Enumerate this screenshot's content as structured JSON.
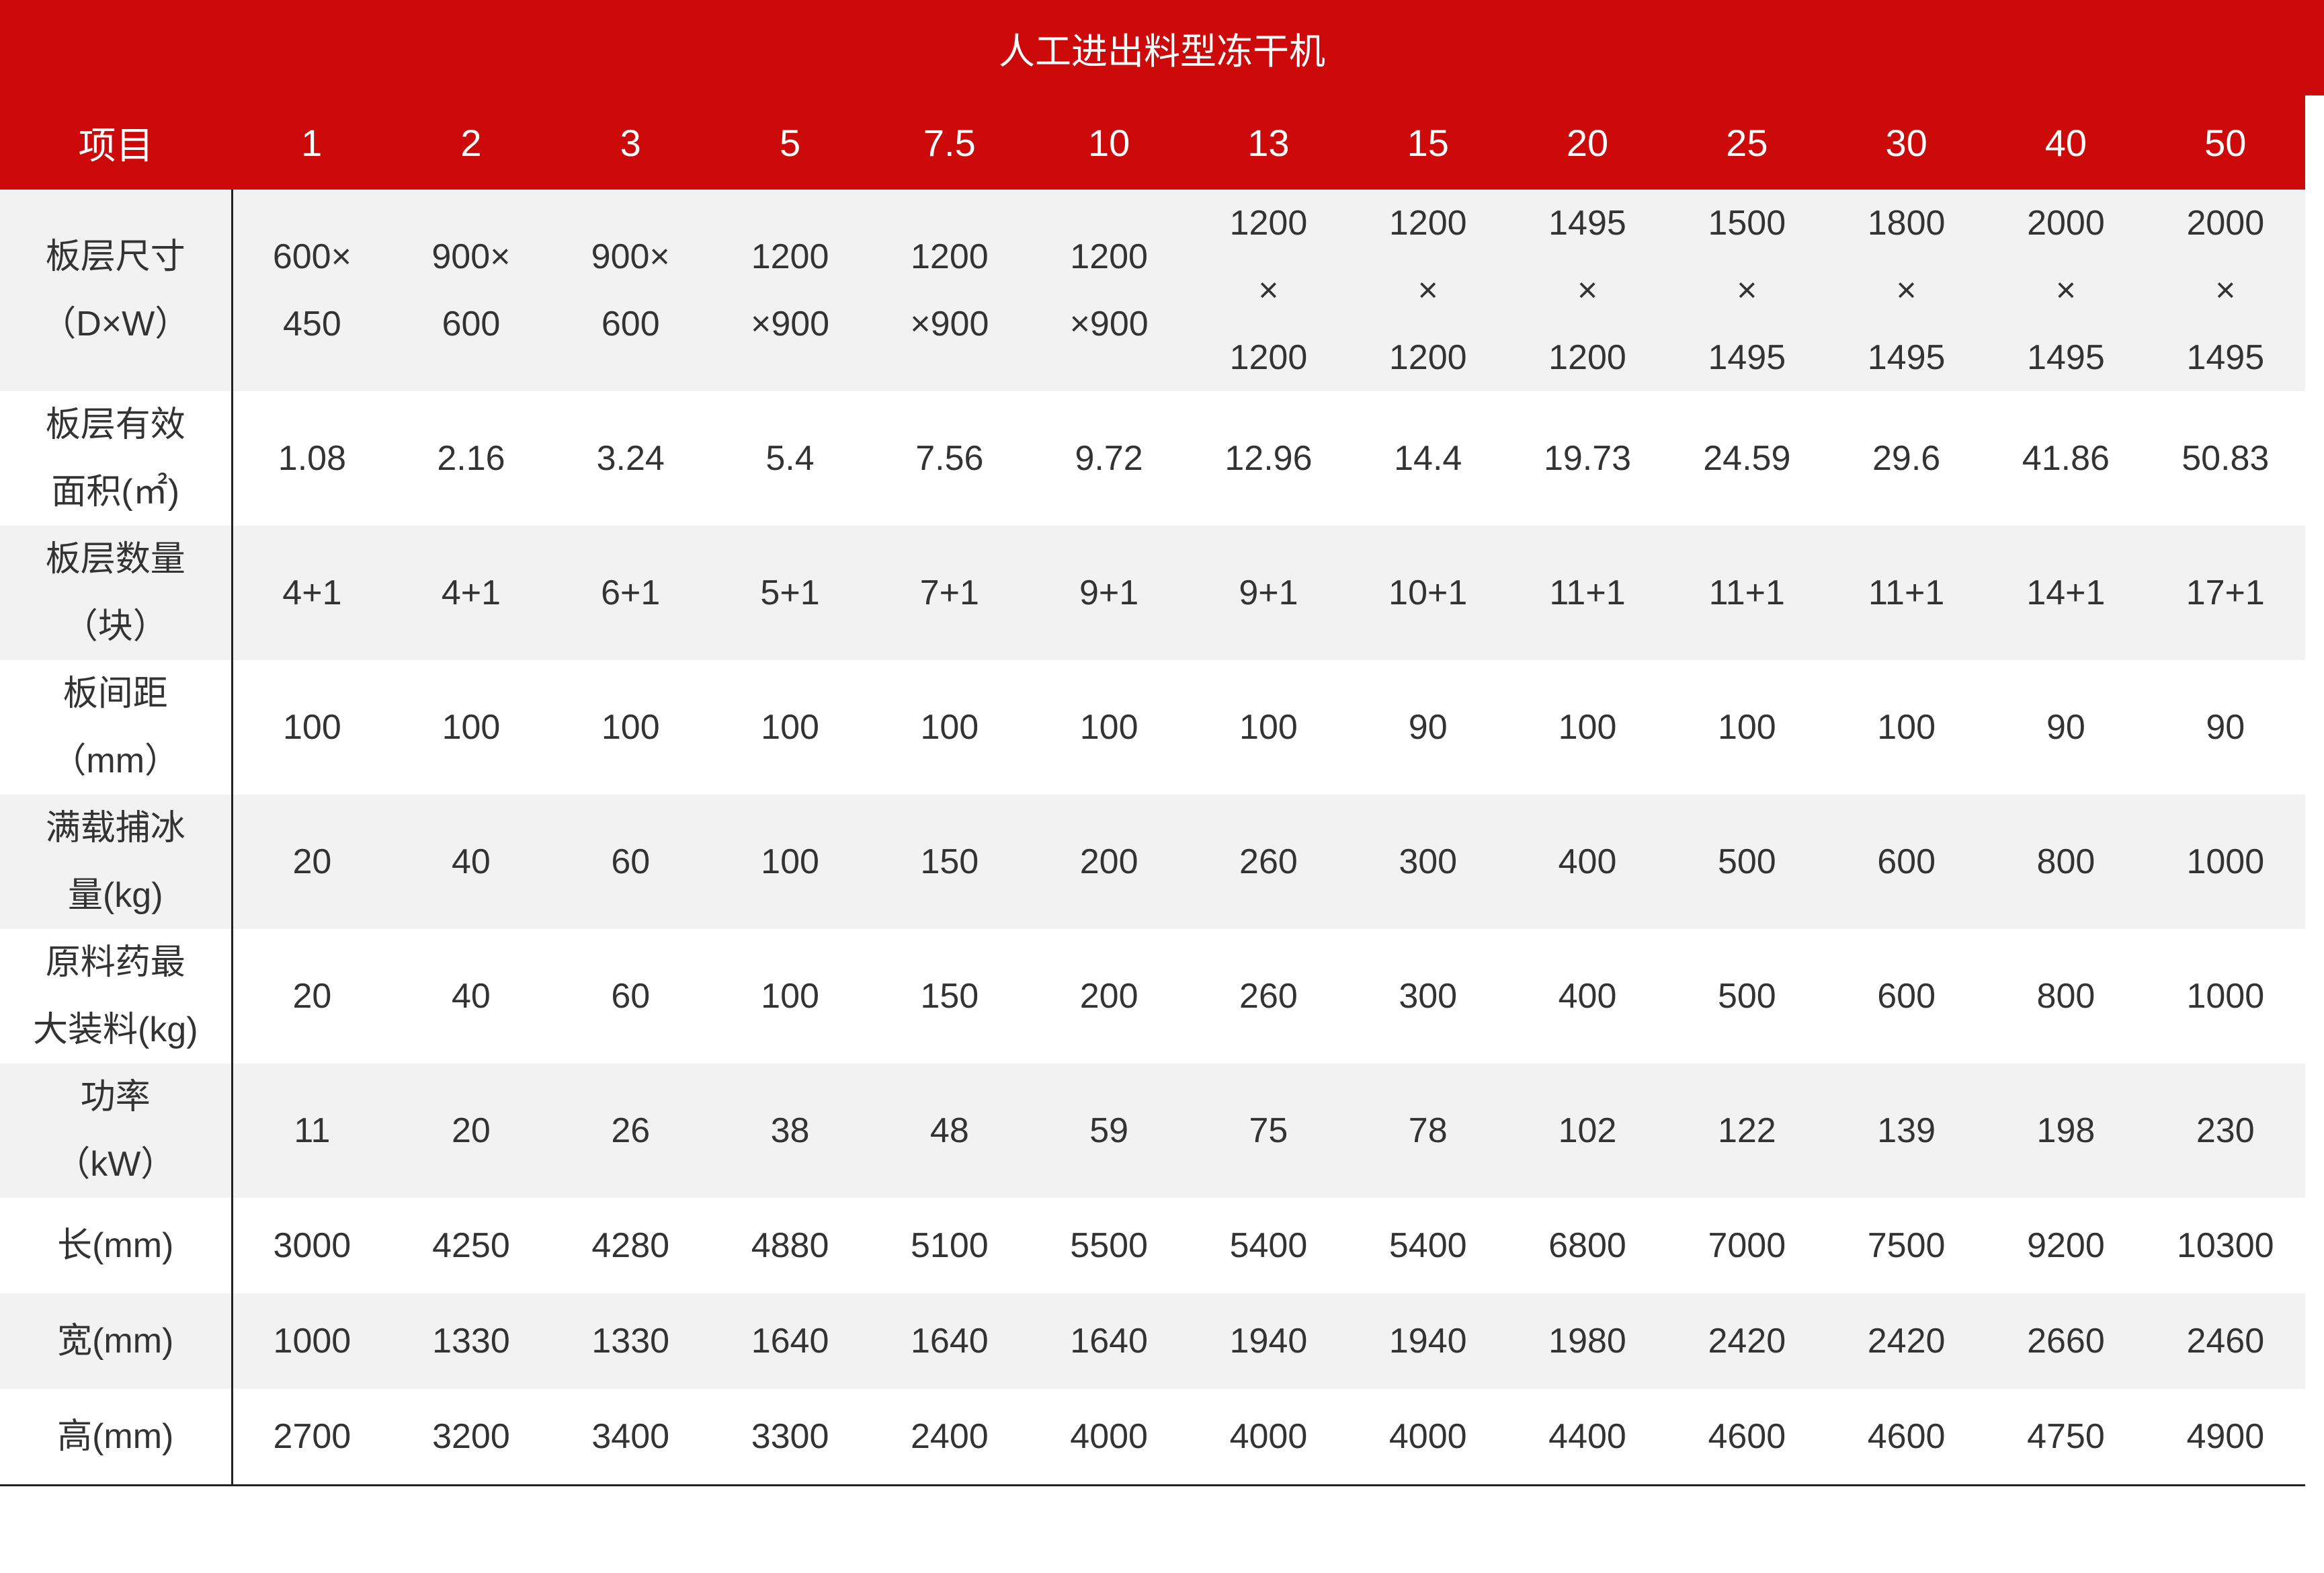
{
  "title": "人工进出料型冻干机",
  "header": {
    "label": "项目",
    "models": [
      "1",
      "2",
      "3",
      "5",
      "7.5",
      "10",
      "13",
      "15",
      "20",
      "25",
      "30",
      "40",
      "50"
    ]
  },
  "rows": [
    {
      "label": "板层尺寸\n（D×W）",
      "values": [
        "600×\n450",
        "900×\n600",
        "900×\n600",
        "1200\n×900",
        "1200\n×900",
        "1200\n×900",
        "1200\n×\n1200",
        "1200\n×\n1200",
        "1495\n×\n1200",
        "1500\n×\n1495",
        "1800\n×\n1495",
        "2000\n×\n1495",
        "2000\n×\n1495"
      ]
    },
    {
      "label": "板层有效\n面积(㎡)",
      "values": [
        "1.08",
        "2.16",
        "3.24",
        "5.4",
        "7.56",
        "9.72",
        "12.96",
        "14.4",
        "19.73",
        "24.59",
        "29.6",
        "41.86",
        "50.83"
      ]
    },
    {
      "label": "板层数量\n（块）",
      "values": [
        "4+1",
        "4+1",
        "6+1",
        "5+1",
        "7+1",
        "9+1",
        "9+1",
        "10+1",
        "11+1",
        "11+1",
        "11+1",
        "14+1",
        "17+1"
      ]
    },
    {
      "label": "板间距\n（mm）",
      "values": [
        "100",
        "100",
        "100",
        "100",
        "100",
        "100",
        "100",
        "90",
        "100",
        "100",
        "100",
        "90",
        "90"
      ]
    },
    {
      "label": "满载捕冰\n量(kg)",
      "values": [
        "20",
        "40",
        "60",
        "100",
        "150",
        "200",
        "260",
        "300",
        "400",
        "500",
        "600",
        "800",
        "1000"
      ]
    },
    {
      "label": "原料药最\n大装料(kg)",
      "values": [
        "20",
        "40",
        "60",
        "100",
        "150",
        "200",
        "260",
        "300",
        "400",
        "500",
        "600",
        "800",
        "1000"
      ]
    },
    {
      "label": "功率\n（kW）",
      "values": [
        "11",
        "20",
        "26",
        "38",
        "48",
        "59",
        "75",
        "78",
        "102",
        "122",
        "139",
        "198",
        "230"
      ]
    },
    {
      "label": "长(mm)",
      "values": [
        "3000",
        "4250",
        "4280",
        "4880",
        "5100",
        "5500",
        "5400",
        "5400",
        "6800",
        "7000",
        "7500",
        "9200",
        "10300"
      ]
    },
    {
      "label": "宽(mm)",
      "values": [
        "1000",
        "1330",
        "1330",
        "1640",
        "1640",
        "1640",
        "1940",
        "1940",
        "1980",
        "2420",
        "2420",
        "2660",
        "2460"
      ]
    },
    {
      "label": "高(mm)",
      "values": [
        "2700",
        "3200",
        "3400",
        "3300",
        "2400",
        "4000",
        "4000",
        "4000",
        "4400",
        "4600",
        "4600",
        "4750",
        "4900"
      ]
    }
  ],
  "colors": {
    "header_bg": "#cc0a0a",
    "stripe_bg": "#f2f2f2",
    "text": "#333333"
  }
}
